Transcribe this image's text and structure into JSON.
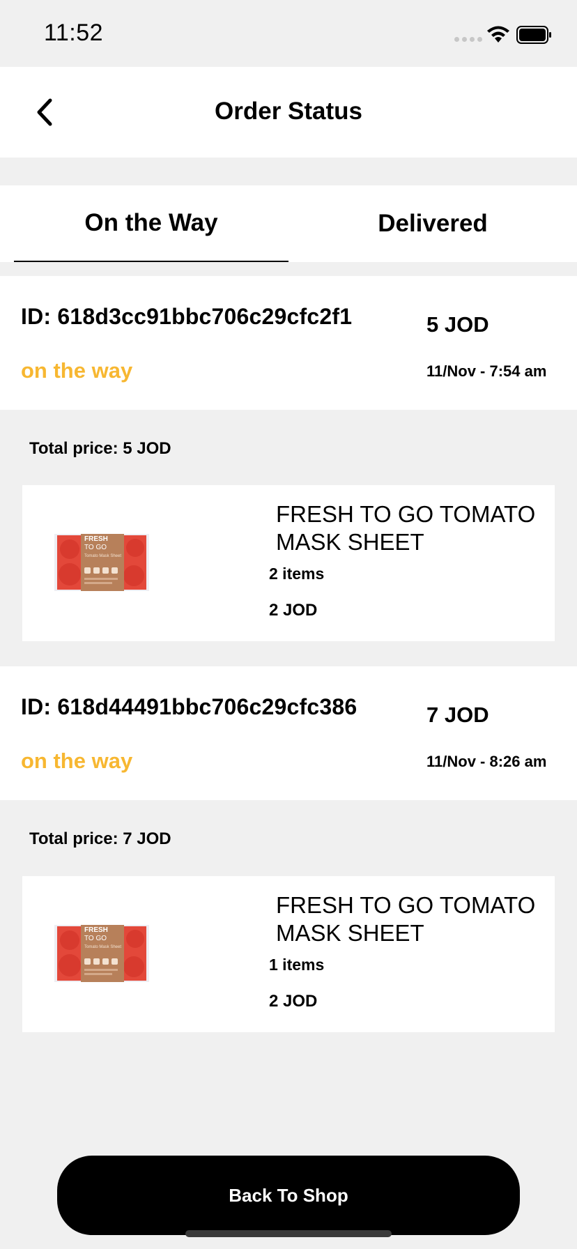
{
  "status_bar": {
    "time": "11:52"
  },
  "header": {
    "title": "Order Status"
  },
  "tabs": [
    {
      "label": "On the Way",
      "active": true
    },
    {
      "label": "Delivered",
      "active": false
    }
  ],
  "orders": [
    {
      "id": "ID: 618d3cc91bbc706c29cfc2f1",
      "status": "on the way",
      "price": "5 JOD",
      "date": "11/Nov - 7:54 am",
      "total_price": "Total price:  5 JOD",
      "items": [
        {
          "name": "FRESH TO GO TOMATO MASK SHEET",
          "quantity": "2 items",
          "price": "2 JOD"
        }
      ]
    },
    {
      "id": "ID: 618d44491bbc706c29cfc386",
      "status": "on the way",
      "price": "7 JOD",
      "date": "11/Nov - 8:26 am",
      "total_price": "Total price:  7 JOD",
      "items": [
        {
          "name": "FRESH TO GO TOMATO MASK SHEET",
          "quantity": "1 items",
          "price": "2 JOD"
        }
      ]
    }
  ],
  "product_thumb_text": {
    "brand_line1": "FRESH",
    "brand_line2": "TO GO",
    "subtitle": "Tomato Mask Sheet"
  },
  "footer": {
    "button_label": "Back To Shop"
  },
  "colors": {
    "status_accent": "#f7b731",
    "button_bg": "#000000",
    "page_bg": "#f0f0f0"
  },
  "icons": {
    "back": "chevron-left-icon",
    "wifi": "wifi-icon",
    "battery": "battery-icon"
  }
}
